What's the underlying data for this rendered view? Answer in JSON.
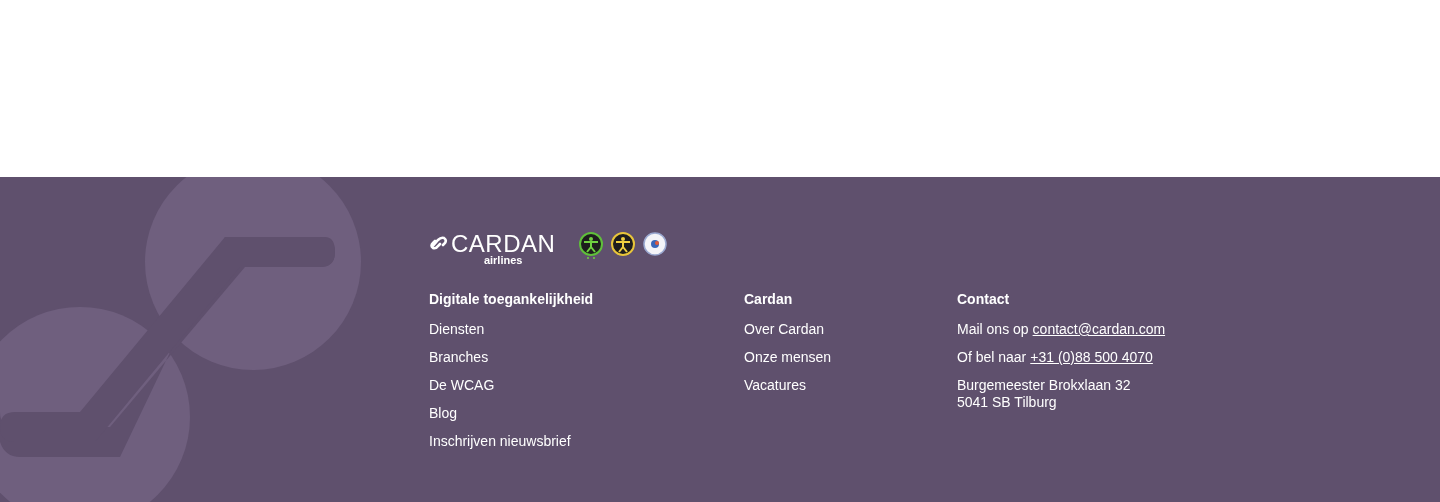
{
  "brand": {
    "name": "CARDAN",
    "sub": "airlines"
  },
  "columns": [
    {
      "heading": "Digitale toegankelijkheid",
      "links": [
        "Diensten",
        "Branches",
        "De WCAG",
        "Blog",
        "Inschrijven nieuwsbrief"
      ]
    },
    {
      "heading": "Cardan",
      "links": [
        "Over Cardan",
        "Onze mensen",
        "Vacatures"
      ]
    }
  ],
  "contact": {
    "heading": "Contact",
    "lines": [
      {
        "kind": "link",
        "prefix": "Mail ons op",
        "link": "contact@cardan.com"
      },
      {
        "kind": "link",
        "prefix": "Of bel naar",
        "link": "+31 (0)88 500 4070"
      },
      {
        "kind": "address",
        "text": "Burgemeester Brokxlaan 32\n5041 SB Tilburg"
      }
    ]
  }
}
